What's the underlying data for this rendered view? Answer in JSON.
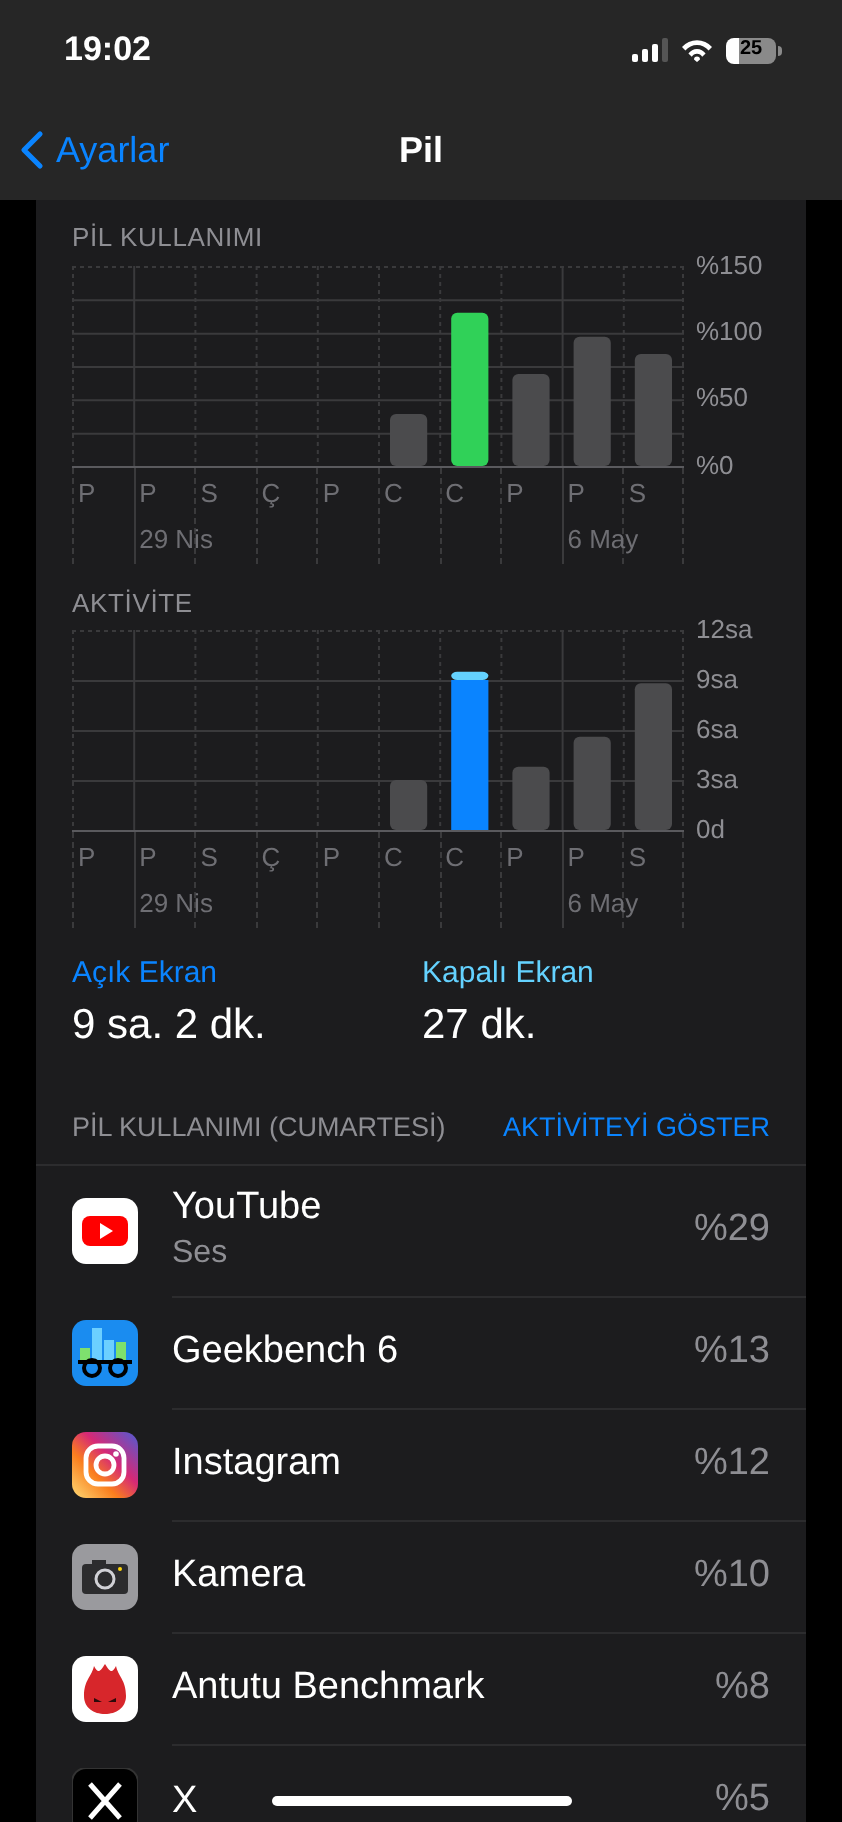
{
  "status_bar": {
    "time": "19:02",
    "battery": "25"
  },
  "nav": {
    "back": "Ayarlar",
    "title": "Pil"
  },
  "battery_chart": {
    "title": "PİL KULLANIMI",
    "bars": [
      {
        "selected": false
      },
      {
        "selected": false,
        "date": "29 Nis"
      },
      {
        "selected": false
      },
      {
        "selected": false
      },
      {
        "selected": false
      },
      {
        "selected": false
      },
      {
        "selected": true
      },
      {
        "selected": false
      },
      {
        "selected": false,
        "date": "6 May"
      },
      {
        "selected": false
      }
    ],
    "chart_data": {
      "type": "bar",
      "grid": true,
      "categories": [
        "P",
        "P",
        "S",
        "Ç",
        "P",
        "C",
        "C",
        "P",
        "P",
        "S"
      ],
      "values": [
        0,
        0,
        0,
        0,
        0,
        39,
        115,
        69,
        97,
        84
      ],
      "ylim": [
        0,
        150
      ],
      "yticks": [
        {
          "value": 0,
          "label": "%0"
        },
        {
          "value": 50,
          "label": "%50"
        },
        {
          "value": 100,
          "label": "%100"
        },
        {
          "value": 150,
          "label": "%150"
        }
      ]
    }
  },
  "activity_chart": {
    "title": "AKTİVİTE",
    "chart_data": {
      "type": "bar",
      "grid": true,
      "stacked": true,
      "categories": [
        "P",
        "P",
        "S",
        "Ç",
        "P",
        "C",
        "C",
        "P",
        "P",
        "S"
      ],
      "series": [
        {
          "name": "Açık Ekran",
          "colors": [
            null,
            null,
            null,
            null,
            null,
            "#4b4b4d",
            "#0a84ff",
            "#4b4b4d",
            "#4b4b4d",
            "#4b4b4d"
          ],
          "values": [
            0,
            0,
            0,
            0,
            0,
            3,
            9,
            3.8,
            5.6,
            8.8
          ]
        },
        {
          "name": "Kapalı Ekran",
          "colors": [
            null,
            null,
            null,
            null,
            null,
            null,
            "#64d2ff",
            null,
            null,
            null
          ],
          "values": [
            0,
            0,
            0,
            0,
            0,
            0,
            0.5,
            0,
            0,
            0
          ]
        }
      ],
      "ylim": [
        0,
        12
      ],
      "yticks": [
        {
          "value": 0,
          "label": "0d"
        },
        {
          "value": 3,
          "label": "3sa"
        },
        {
          "value": 6,
          "label": "6sa"
        },
        {
          "value": 9,
          "label": "9sa"
        },
        {
          "value": 12,
          "label": "12sa"
        }
      ]
    },
    "week_dates": [
      {
        "label": "29 Nis"
      },
      {
        "label": "6 May"
      }
    ],
    "legend": [
      {
        "color": "#0a84ff",
        "value": "9 sa. 2 dk."
      },
      {
        "color": "#64d2ff",
        "value": "27 dk."
      }
    ]
  },
  "usage": {
    "header": "PİL KULLANIMI (CUMARTESİ)",
    "action": "AKTİVİTEYİ GÖSTER",
    "apps": [
      {
        "kind": "youtube",
        "name": "YouTube",
        "detail": "Ses",
        "percent": "%29"
      },
      {
        "kind": "geekbench",
        "name": "Geekbench 6",
        "percent": "%13"
      },
      {
        "kind": "instagram",
        "name": "Instagram",
        "percent": "%12"
      },
      {
        "kind": "camera",
        "name": "Kamera",
        "percent": "%10"
      },
      {
        "kind": "antutu",
        "name": "Antutu Benchmark",
        "percent": "%8"
      },
      {
        "kind": "x",
        "name": "X",
        "percent": "%5"
      }
    ]
  }
}
